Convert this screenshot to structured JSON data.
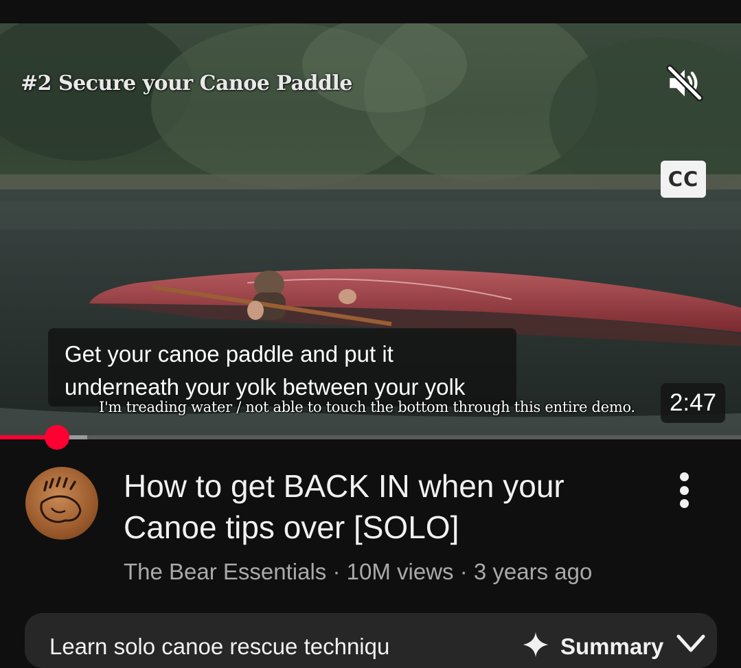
{
  "video": {
    "burned_title": "#2 Secure your Canoe Paddle",
    "captions": {
      "line1": "Get your canoe paddle and put it",
      "line2": "underneath your yolk between your yolk"
    },
    "burned_subtitle": "I'm treading water / not able to touch the bottom through this entire demo.",
    "cc_label": "CC",
    "duration": "2:47",
    "progress": {
      "played_fraction": 0.077,
      "buffered_fraction": 0.118
    }
  },
  "meta": {
    "title_line1": "How to get BACK IN when your",
    "title_line2": "Canoe tips over [SOLO]",
    "channel": "The Bear Essentials",
    "views": "10M views",
    "age": "3 years ago",
    "separator": " · "
  },
  "summary": {
    "text": "Learn solo canoe rescue techniqu",
    "label": "Summary"
  },
  "colors": {
    "accent": "#ff0033",
    "background": "#0f0f0f",
    "secondary_text": "#aaaaaa"
  },
  "icons": {
    "mute": "volume-muted-icon",
    "more": "more-vertical-icon",
    "sparkle": "sparkle-icon",
    "chevron": "chevron-down-icon"
  }
}
